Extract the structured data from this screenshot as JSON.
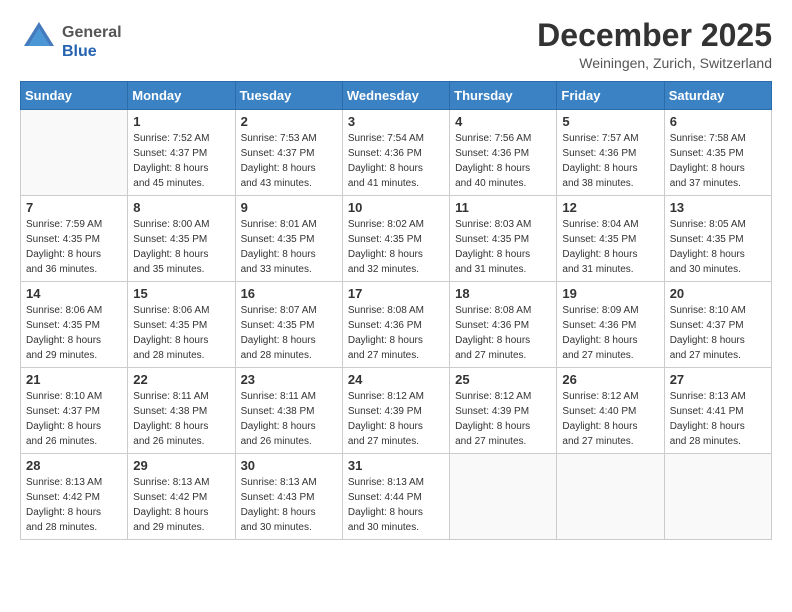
{
  "header": {
    "logo_general": "General",
    "logo_blue": "Blue",
    "month_title": "December 2025",
    "location": "Weiningen, Zurich, Switzerland"
  },
  "weekdays": [
    "Sunday",
    "Monday",
    "Tuesday",
    "Wednesday",
    "Thursday",
    "Friday",
    "Saturday"
  ],
  "weeks": [
    [
      {
        "day": "",
        "info": ""
      },
      {
        "day": "1",
        "info": "Sunrise: 7:52 AM\nSunset: 4:37 PM\nDaylight: 8 hours\nand 45 minutes."
      },
      {
        "day": "2",
        "info": "Sunrise: 7:53 AM\nSunset: 4:37 PM\nDaylight: 8 hours\nand 43 minutes."
      },
      {
        "day": "3",
        "info": "Sunrise: 7:54 AM\nSunset: 4:36 PM\nDaylight: 8 hours\nand 41 minutes."
      },
      {
        "day": "4",
        "info": "Sunrise: 7:56 AM\nSunset: 4:36 PM\nDaylight: 8 hours\nand 40 minutes."
      },
      {
        "day": "5",
        "info": "Sunrise: 7:57 AM\nSunset: 4:36 PM\nDaylight: 8 hours\nand 38 minutes."
      },
      {
        "day": "6",
        "info": "Sunrise: 7:58 AM\nSunset: 4:35 PM\nDaylight: 8 hours\nand 37 minutes."
      }
    ],
    [
      {
        "day": "7",
        "info": "Sunrise: 7:59 AM\nSunset: 4:35 PM\nDaylight: 8 hours\nand 36 minutes."
      },
      {
        "day": "8",
        "info": "Sunrise: 8:00 AM\nSunset: 4:35 PM\nDaylight: 8 hours\nand 35 minutes."
      },
      {
        "day": "9",
        "info": "Sunrise: 8:01 AM\nSunset: 4:35 PM\nDaylight: 8 hours\nand 33 minutes."
      },
      {
        "day": "10",
        "info": "Sunrise: 8:02 AM\nSunset: 4:35 PM\nDaylight: 8 hours\nand 32 minutes."
      },
      {
        "day": "11",
        "info": "Sunrise: 8:03 AM\nSunset: 4:35 PM\nDaylight: 8 hours\nand 31 minutes."
      },
      {
        "day": "12",
        "info": "Sunrise: 8:04 AM\nSunset: 4:35 PM\nDaylight: 8 hours\nand 31 minutes."
      },
      {
        "day": "13",
        "info": "Sunrise: 8:05 AM\nSunset: 4:35 PM\nDaylight: 8 hours\nand 30 minutes."
      }
    ],
    [
      {
        "day": "14",
        "info": "Sunrise: 8:06 AM\nSunset: 4:35 PM\nDaylight: 8 hours\nand 29 minutes."
      },
      {
        "day": "15",
        "info": "Sunrise: 8:06 AM\nSunset: 4:35 PM\nDaylight: 8 hours\nand 28 minutes."
      },
      {
        "day": "16",
        "info": "Sunrise: 8:07 AM\nSunset: 4:35 PM\nDaylight: 8 hours\nand 28 minutes."
      },
      {
        "day": "17",
        "info": "Sunrise: 8:08 AM\nSunset: 4:36 PM\nDaylight: 8 hours\nand 27 minutes."
      },
      {
        "day": "18",
        "info": "Sunrise: 8:08 AM\nSunset: 4:36 PM\nDaylight: 8 hours\nand 27 minutes."
      },
      {
        "day": "19",
        "info": "Sunrise: 8:09 AM\nSunset: 4:36 PM\nDaylight: 8 hours\nand 27 minutes."
      },
      {
        "day": "20",
        "info": "Sunrise: 8:10 AM\nSunset: 4:37 PM\nDaylight: 8 hours\nand 27 minutes."
      }
    ],
    [
      {
        "day": "21",
        "info": "Sunrise: 8:10 AM\nSunset: 4:37 PM\nDaylight: 8 hours\nand 26 minutes."
      },
      {
        "day": "22",
        "info": "Sunrise: 8:11 AM\nSunset: 4:38 PM\nDaylight: 8 hours\nand 26 minutes."
      },
      {
        "day": "23",
        "info": "Sunrise: 8:11 AM\nSunset: 4:38 PM\nDaylight: 8 hours\nand 26 minutes."
      },
      {
        "day": "24",
        "info": "Sunrise: 8:12 AM\nSunset: 4:39 PM\nDaylight: 8 hours\nand 27 minutes."
      },
      {
        "day": "25",
        "info": "Sunrise: 8:12 AM\nSunset: 4:39 PM\nDaylight: 8 hours\nand 27 minutes."
      },
      {
        "day": "26",
        "info": "Sunrise: 8:12 AM\nSunset: 4:40 PM\nDaylight: 8 hours\nand 27 minutes."
      },
      {
        "day": "27",
        "info": "Sunrise: 8:13 AM\nSunset: 4:41 PM\nDaylight: 8 hours\nand 28 minutes."
      }
    ],
    [
      {
        "day": "28",
        "info": "Sunrise: 8:13 AM\nSunset: 4:42 PM\nDaylight: 8 hours\nand 28 minutes."
      },
      {
        "day": "29",
        "info": "Sunrise: 8:13 AM\nSunset: 4:42 PM\nDaylight: 8 hours\nand 29 minutes."
      },
      {
        "day": "30",
        "info": "Sunrise: 8:13 AM\nSunset: 4:43 PM\nDaylight: 8 hours\nand 30 minutes."
      },
      {
        "day": "31",
        "info": "Sunrise: 8:13 AM\nSunset: 4:44 PM\nDaylight: 8 hours\nand 30 minutes."
      },
      {
        "day": "",
        "info": ""
      },
      {
        "day": "",
        "info": ""
      },
      {
        "day": "",
        "info": ""
      }
    ]
  ]
}
